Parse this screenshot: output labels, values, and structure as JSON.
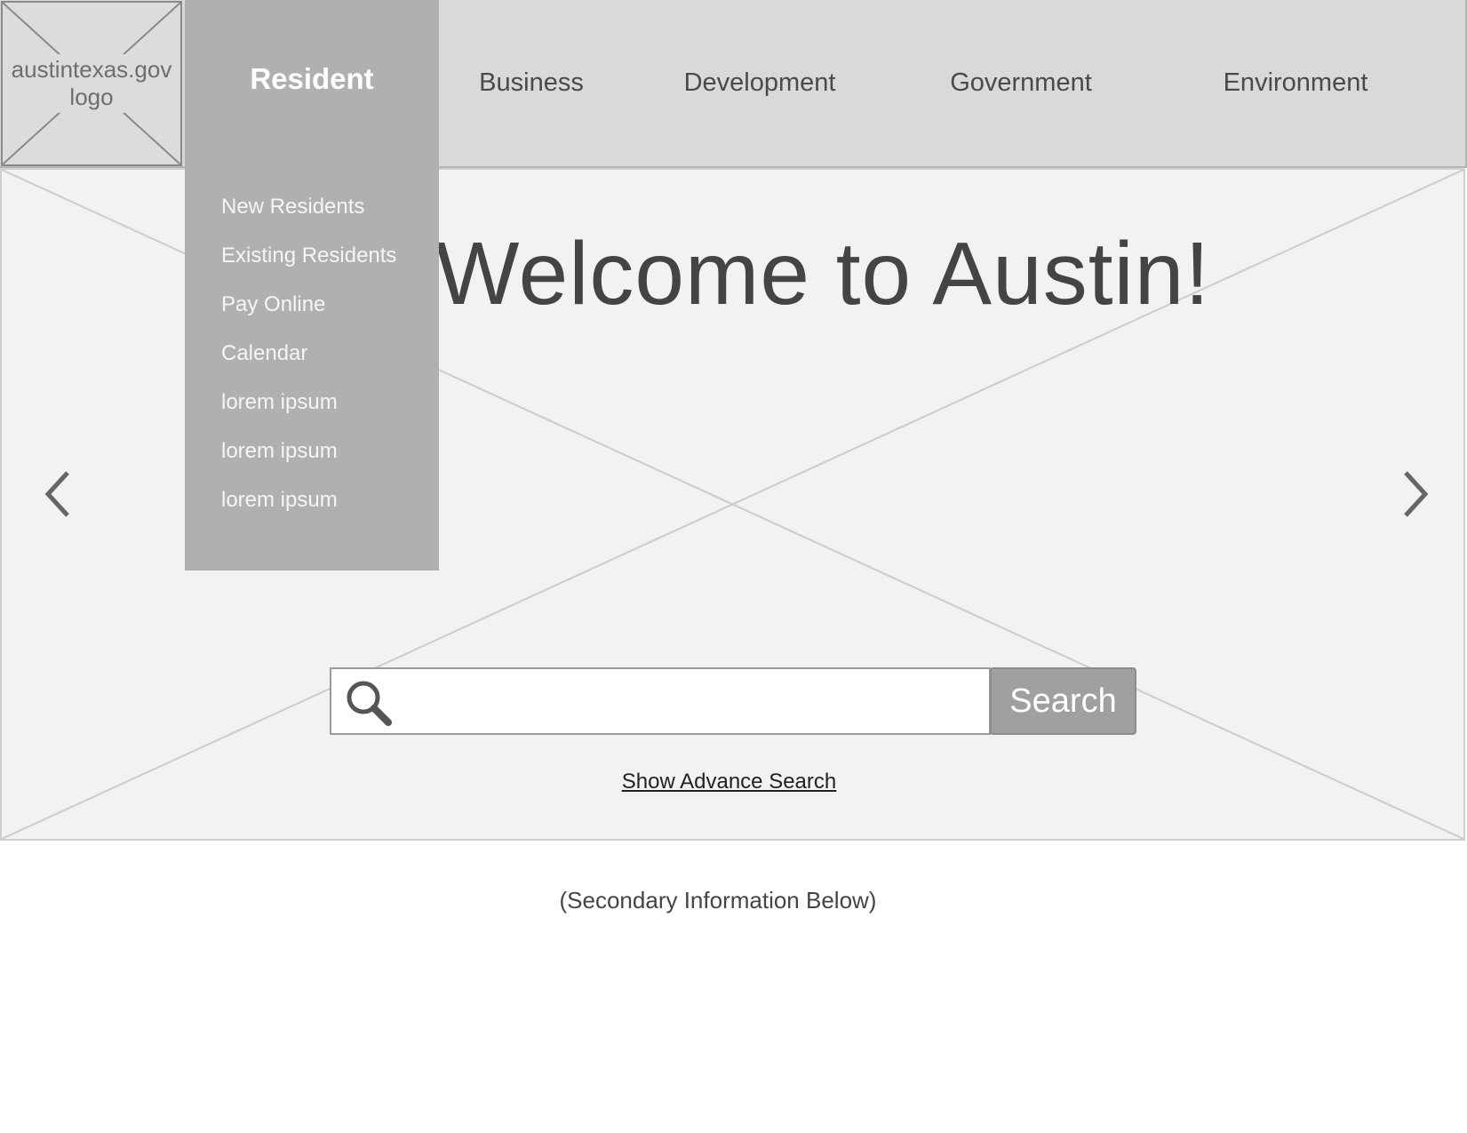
{
  "logo": {
    "text_line1": "austintexas.gov",
    "text_line2": "logo"
  },
  "nav": {
    "items": [
      {
        "label": "Resident",
        "active": true
      },
      {
        "label": "Business"
      },
      {
        "label": "Development"
      },
      {
        "label": "Government"
      },
      {
        "label": "Environment"
      }
    ],
    "resident_dropdown": [
      "New Residents",
      "Existing Residents",
      "Pay Online",
      "Calendar",
      "lorem ipsum",
      "lorem ipsum",
      "lorem ipsum"
    ]
  },
  "hero": {
    "title": "Welcome to Austin!",
    "prev_icon": "chevron-left-icon",
    "next_icon": "chevron-right-icon"
  },
  "search": {
    "value": "",
    "icon": "search-icon",
    "button_label": "Search",
    "advance_link": "Show Advance Search"
  },
  "footer_note": "(Secondary Information Below)",
  "colors": {
    "header_bg": "#d9d9d9",
    "active_nav_bg": "#b0b0b0",
    "hero_bg": "#f2f2f2",
    "search_button_bg": "#a0a0a0"
  }
}
